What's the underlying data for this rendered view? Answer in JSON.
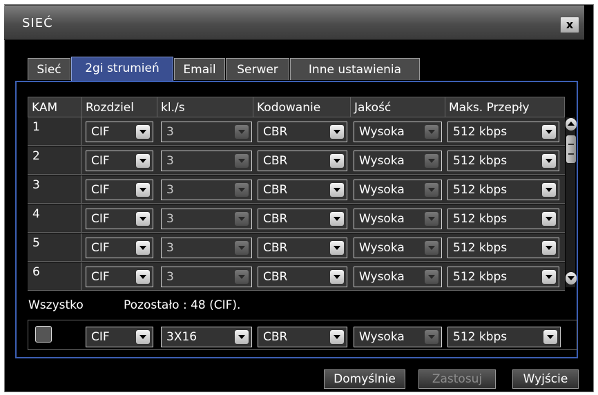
{
  "window": {
    "title": "SIEĆ",
    "close_label": "x"
  },
  "tabs": [
    {
      "label": "Sieć",
      "active": false
    },
    {
      "label": "2gi strumień",
      "active": true
    },
    {
      "label": "Email",
      "active": false
    },
    {
      "label": "Serwer",
      "active": false
    },
    {
      "label": "Inne ustawienia",
      "active": false
    }
  ],
  "table": {
    "headers": [
      "KAM",
      "Rozdziel",
      "kl./s",
      "Kodowanie",
      "Jakość",
      "Maks. Przepły"
    ],
    "rows": [
      {
        "cam": "1",
        "resolution": "CIF",
        "fps": "3",
        "encoding": "CBR",
        "quality": "Wysoka",
        "max_bitrate": "512 kbps"
      },
      {
        "cam": "2",
        "resolution": "CIF",
        "fps": "3",
        "encoding": "CBR",
        "quality": "Wysoka",
        "max_bitrate": "512 kbps"
      },
      {
        "cam": "3",
        "resolution": "CIF",
        "fps": "3",
        "encoding": "CBR",
        "quality": "Wysoka",
        "max_bitrate": "512 kbps"
      },
      {
        "cam": "4",
        "resolution": "CIF",
        "fps": "3",
        "encoding": "CBR",
        "quality": "Wysoka",
        "max_bitrate": "512 kbps"
      },
      {
        "cam": "5",
        "resolution": "CIF",
        "fps": "3",
        "encoding": "CBR",
        "quality": "Wysoka",
        "max_bitrate": "512 kbps"
      },
      {
        "cam": "6",
        "resolution": "CIF",
        "fps": "3",
        "encoding": "CBR",
        "quality": "Wysoka",
        "max_bitrate": "512 kbps"
      }
    ]
  },
  "all": {
    "label": "Wszystko",
    "remaining": "Pozostało : 48 (CIF).",
    "checked": false,
    "resolution": "CIF",
    "fps": "3X16",
    "encoding": "CBR",
    "quality": "Wysoka",
    "max_bitrate": "512 kbps"
  },
  "buttons": {
    "default": "Domyślnie",
    "apply": "Zastosuj",
    "exit": "Wyjście"
  },
  "colors": {
    "active_tab": "#3a4f91",
    "panel_border": "#3c5fb4",
    "background": "#000000"
  }
}
